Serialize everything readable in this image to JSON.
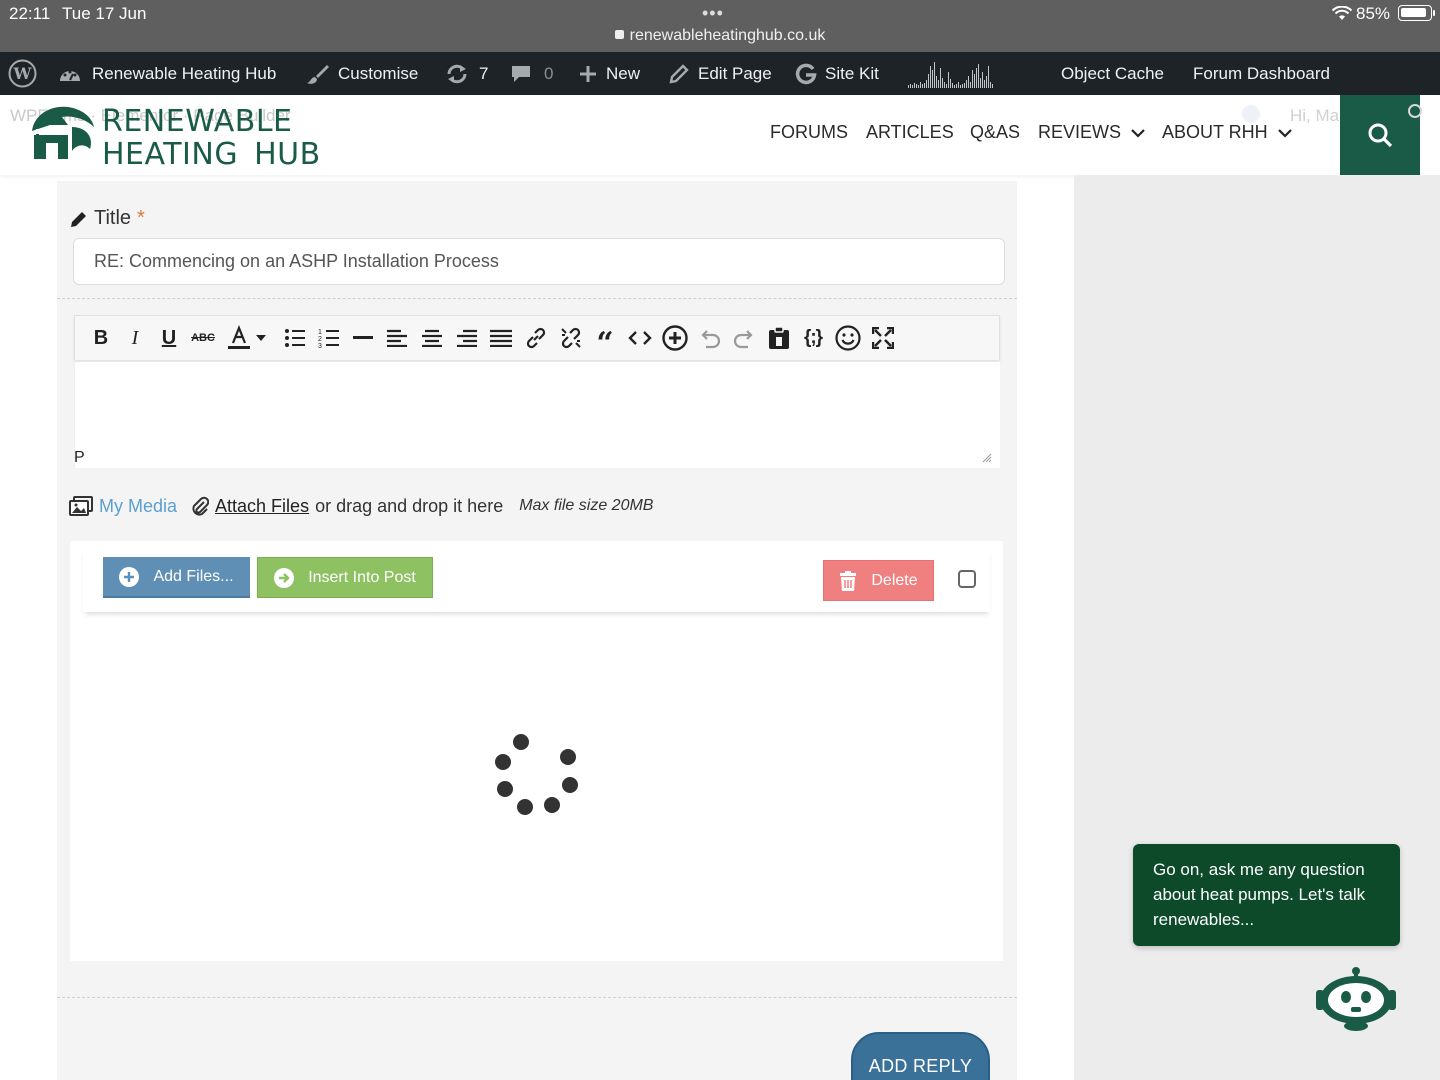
{
  "status_bar": {
    "time": "22:11",
    "date": "Tue 17 Jun",
    "url": "renewableheatinghub.co.uk",
    "battery": "85%"
  },
  "admin_bar": {
    "site_name": "Renewable Heating Hub",
    "customise": "Customise",
    "updates_count": "7",
    "comments_count": "0",
    "new": "New",
    "edit_page": "Edit Page",
    "site_kit": "Site Kit",
    "object_cache": "Object Cache",
    "forum_dashboard": "Forum Dashboard"
  },
  "header": {
    "ghost_text": "WPForms · Elementor · Page Builder",
    "logo_line1": "RENEWABLE",
    "logo_line2": "HEATING HUB",
    "nav": {
      "forums": "FORUMS",
      "articles": "ARTICLES",
      "qas": "Q&AS",
      "reviews": "REVIEWS",
      "about": "ABOUT RHH"
    },
    "greeting": "Hi, Mars"
  },
  "form": {
    "title_label": "Title",
    "required_mark": "*",
    "title_value": "RE: Commencing on an ASHP Installation Process",
    "editor_path": "P",
    "my_media": "My Media",
    "attach_files": "Attach Files",
    "drag_text": "or drag and drop it here",
    "max_size": "Max file size 20MB",
    "add_files": "Add Files...",
    "insert_into_post": "Insert Into Post",
    "delete": "Delete",
    "add_reply": "ADD REPLY"
  },
  "toolbar_icons": [
    "bold-icon",
    "italic-icon",
    "underline-icon",
    "strikethrough-icon",
    "text-color-icon",
    "dropdown-caret-icon",
    "bullet-list-icon",
    "numbered-list-icon",
    "horizontal-rule-icon",
    "align-left-icon",
    "align-center-icon",
    "align-right-icon",
    "align-justify-icon",
    "link-icon",
    "unlink-icon",
    "blockquote-icon",
    "code-icon",
    "insert-plus-icon",
    "undo-icon",
    "redo-icon",
    "paste-icon",
    "source-code-icon",
    "emoji-icon",
    "fullscreen-icon"
  ],
  "chat": {
    "message": "Go on, ask me any question about heat pumps. Let's talk renewables..."
  },
  "colors": {
    "brand_green": "#1a5b48",
    "chat_green": "#0c4a2a",
    "admin_bar": "#1d2327",
    "add_files_blue": "#5f8fb4",
    "insert_green": "#8ec161",
    "delete_red": "#f08080",
    "reply_blue": "#3a7199"
  }
}
